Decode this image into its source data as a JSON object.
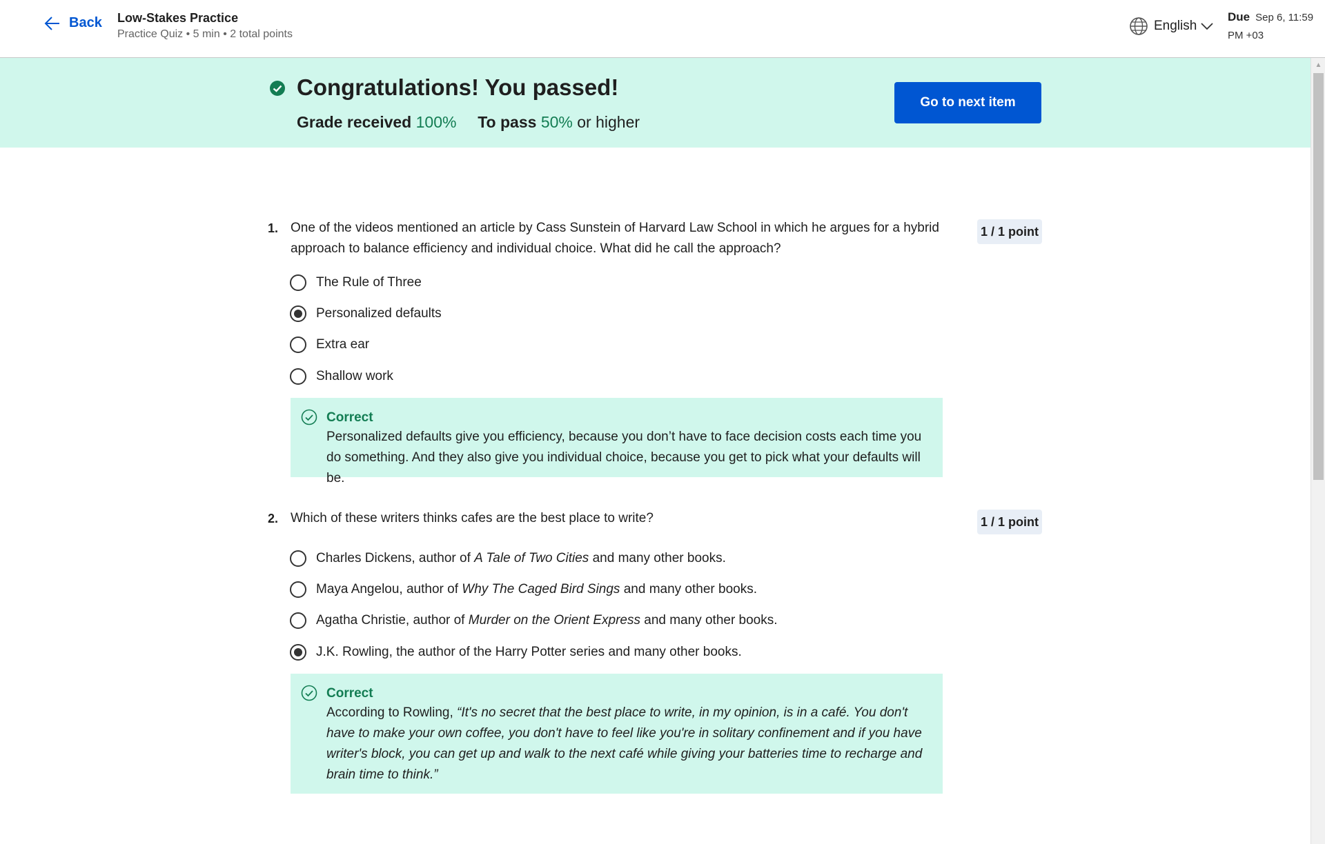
{
  "header": {
    "back_label": "Back",
    "title": "Low-Stakes Practice",
    "meta": "Practice Quiz • 5 min • 2 total points",
    "language": "English",
    "due_label": "Due",
    "due_date": "Sep 6, 11:59 PM +03"
  },
  "banner": {
    "heading": "Congratulations! You passed!",
    "grade_label": "Grade received",
    "grade_value": "100%",
    "pass_label": "To pass",
    "pass_value": "50%",
    "pass_suffix": "or higher",
    "next_button": "Go to next item"
  },
  "questions": [
    {
      "number": "1.",
      "text": "One of the videos mentioned an article by Cass Sunstein of Harvard Law School in which he argues for a hybrid approach to balance efficiency and individual choice. What did he call the approach?",
      "points": "1 / 1 point",
      "options": [
        {
          "label": "The Rule of Three",
          "selected": false
        },
        {
          "label": "Personalized defaults",
          "selected": true
        },
        {
          "label": "Extra ear",
          "selected": false
        },
        {
          "label": "Shallow work",
          "selected": false
        }
      ],
      "feedback": {
        "label": "Correct",
        "text": "Personalized defaults give you efficiency, because you don’t have to face decision costs each time you do something. And they also give you individual choice, because you get to pick what your defaults will be."
      }
    },
    {
      "number": "2.",
      "text": "Which of these writers thinks cafes are the best place to write?",
      "points": "1 / 1 point",
      "options": [
        {
          "prefix": "Charles Dickens, author of ",
          "title": "A Tale of Two Cities",
          "suffix": " and many other books.",
          "selected": false
        },
        {
          "prefix": "Maya Angelou, author of ",
          "title": "Why The Caged Bird Sings",
          "suffix": " and many other books.",
          "selected": false
        },
        {
          "prefix": "Agatha Christie, author of ",
          "title": "Murder on the Orient Express",
          "suffix": " and many other books.",
          "selected": false
        },
        {
          "prefix": "J.K. Rowling, the author of the Harry Potter series and many other books.",
          "title": "",
          "suffix": "",
          "selected": true
        }
      ],
      "feedback": {
        "label": "Correct",
        "intro": "According to Rowling, ",
        "quote": "“It's no secret that the best place to write, in my opinion, is in a café. You don't have to make your own coffee, you don't have to feel like you're in solitary confinement and if you have writer's block, you can get up and walk to the next café while giving your batteries time to recharge and brain time to think.”"
      }
    }
  ],
  "colors": {
    "accent": "#0056d2",
    "success": "#137d53",
    "success_bg": "#d0f7ec"
  }
}
